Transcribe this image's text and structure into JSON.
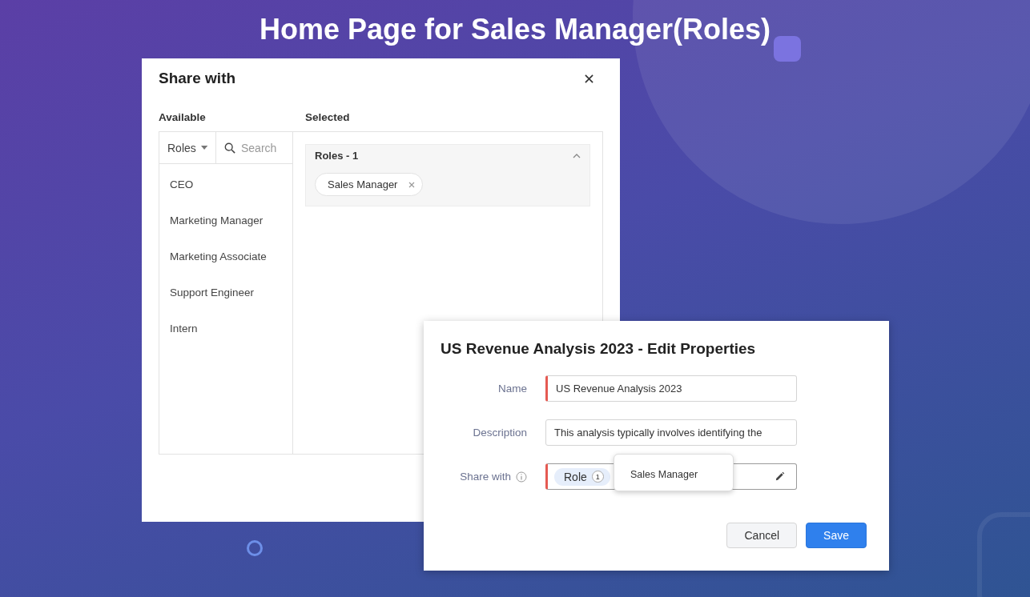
{
  "heading": "Home Page for Sales Manager(Roles)",
  "share_dialog": {
    "title": "Share with",
    "available_label": "Available",
    "selected_label": "Selected",
    "filter": {
      "value": "Roles"
    },
    "search": {
      "placeholder": "Search"
    },
    "available": [
      {
        "label": "CEO"
      },
      {
        "label": "Marketing Manager"
      },
      {
        "label": "Marketing Associate"
      },
      {
        "label": "Support Engineer"
      },
      {
        "label": "Intern"
      }
    ],
    "selected_groups": [
      {
        "title": "Roles - 1",
        "expanded": true,
        "chips": [
          {
            "label": "Sales Manager"
          }
        ]
      }
    ]
  },
  "edit_dialog": {
    "title": "US Revenue Analysis 2023 - Edit Properties",
    "fields": [
      {
        "label": "Name",
        "value": "US Revenue Analysis 2023",
        "required": true
      },
      {
        "label": "Description",
        "value": "This analysis typically involves identifying the",
        "required": false
      }
    ],
    "share_with": {
      "label": "Share with",
      "tag": "Role",
      "count": "1",
      "required": true,
      "popover": "Sales Manager"
    },
    "buttons": [
      {
        "label": "Cancel",
        "kind": "secondary"
      },
      {
        "label": "Save",
        "kind": "primary"
      }
    ]
  }
}
